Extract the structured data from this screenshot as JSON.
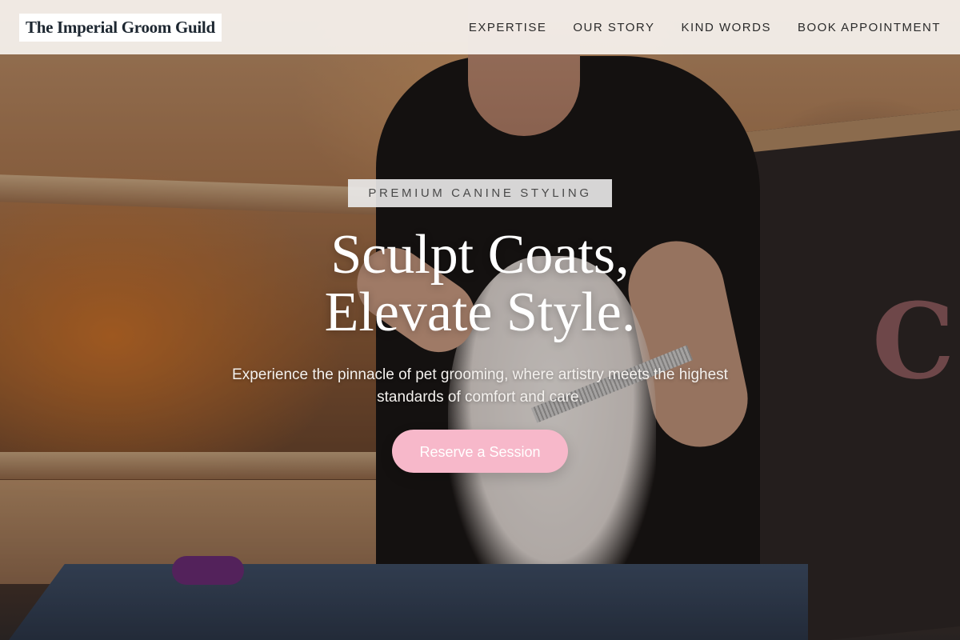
{
  "header": {
    "logo_text": "The Imperial Groom Guild",
    "nav": [
      {
        "label": "EXPERTISE"
      },
      {
        "label": "OUR STORY"
      },
      {
        "label": "KIND WORDS"
      },
      {
        "label": "BOOK APPOINTMENT"
      }
    ]
  },
  "hero": {
    "eyebrow": "PREMIUM CANINE STYLING",
    "headline_line1": "Sculpt Coats,",
    "headline_line2": "Elevate Style.",
    "subtext": "Experience the pinnacle of pet grooming, where artistry meets the highest standards of comfort and care.",
    "cta_label": "Reserve a Session",
    "background_image": "groomer-combing-white-pomeranian-photo"
  },
  "colors": {
    "cta_pink": "#f7b8ca",
    "header_bg": "#faf6f3",
    "logo_text": "#1d2731"
  }
}
